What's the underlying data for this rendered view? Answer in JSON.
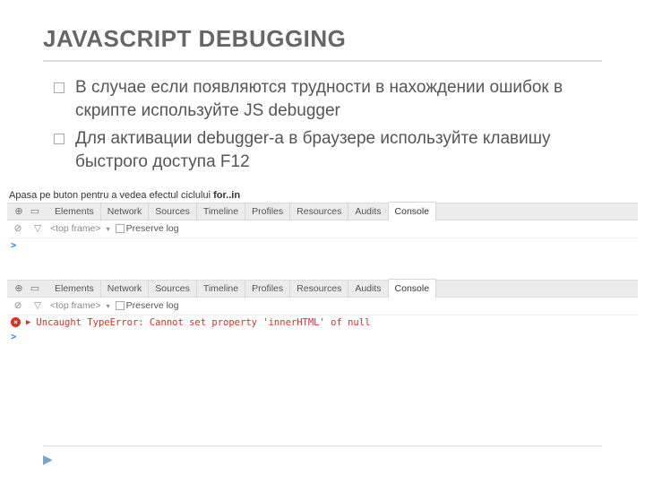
{
  "title": "JAVASCRIPT DEBUGGING",
  "bullets": [
    "В случае если появляются трудности в нахождении ошибок в скрипте используйте JS debugger",
    "Для активации debugger-а в браузере используйте клавишу быстрого доступа F12"
  ],
  "caption_pre": "Apasa pe buton pentru a vedea efectul ciclului ",
  "caption_bold": "for..in",
  "devtools_tabs": [
    "Elements",
    "Network",
    "Sources",
    "Timeline",
    "Profiles",
    "Resources",
    "Audits",
    "Console"
  ],
  "selected_tab": "Console",
  "top_frame": "<top frame>",
  "preserve_log": "Preserve log",
  "prompt_symbol": ">",
  "error_text": "Uncaught TypeError: Cannot set property 'innerHTML' of null",
  "icons": {
    "search": "⊕",
    "device": "▭",
    "clear": "⊘",
    "filter": "▽",
    "dropdown": "▾",
    "err_x": "×",
    "err_arrow": "▶",
    "footer_arrow": "▶"
  }
}
